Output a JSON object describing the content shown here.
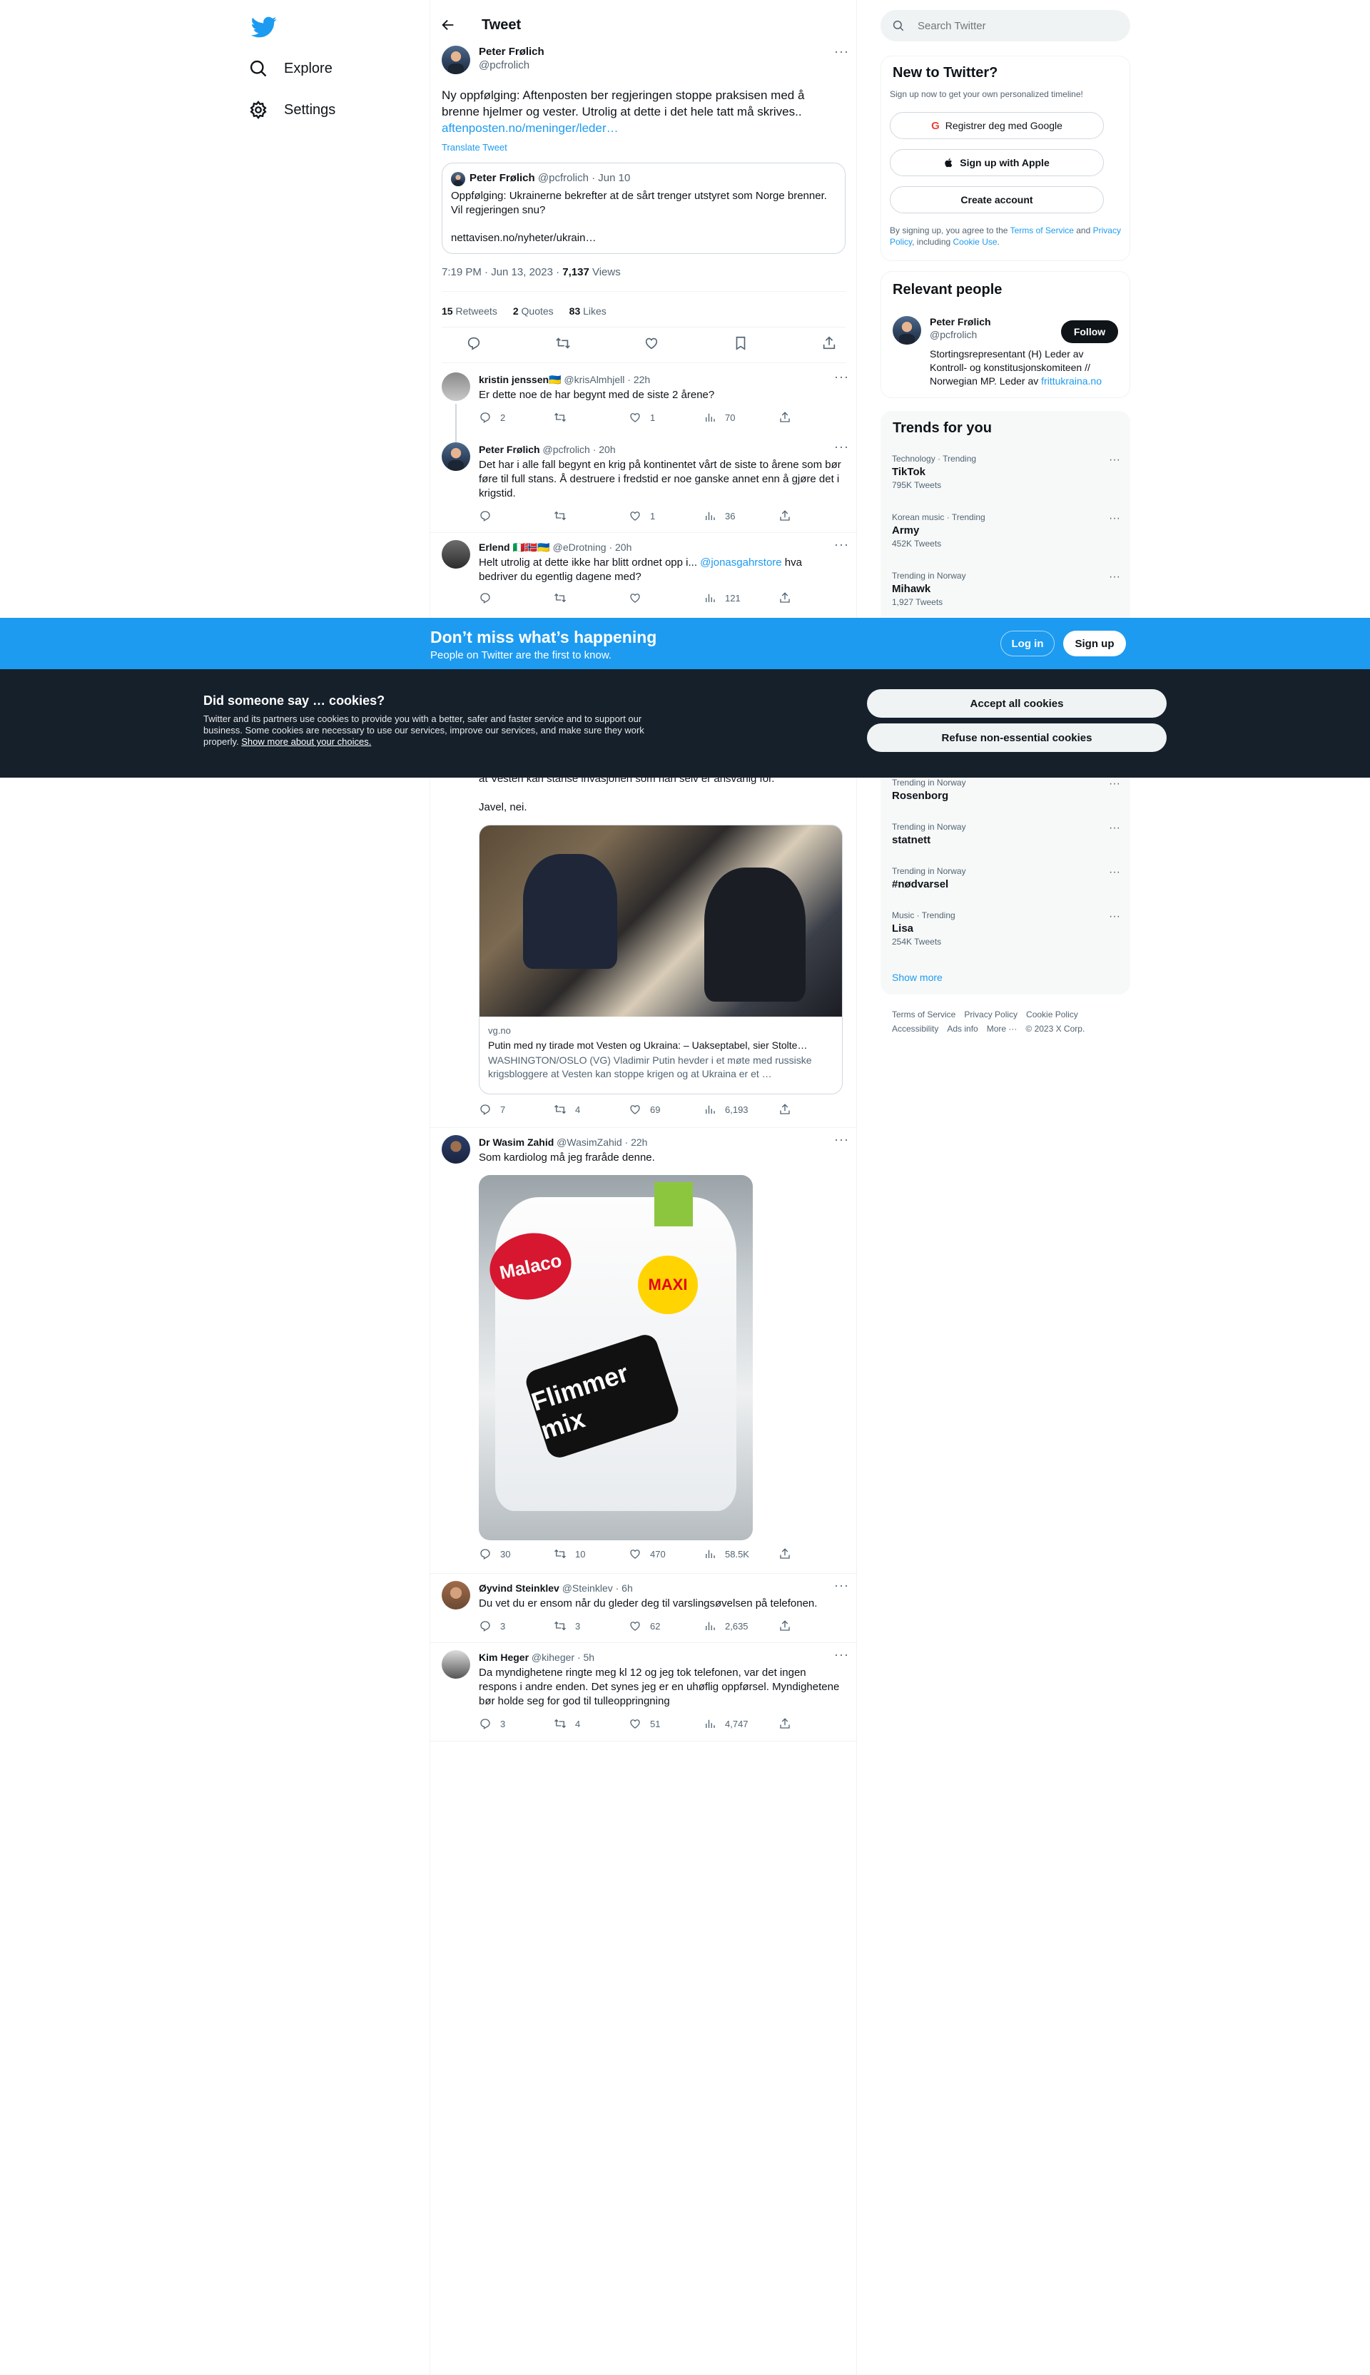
{
  "nav": {
    "explore": "Explore",
    "settings": "Settings"
  },
  "header": {
    "title": "Tweet"
  },
  "main_tweet": {
    "name": "Peter Frølich",
    "handle": "@pcfrolich",
    "text": "Ny oppfølging: Aftenposten ber regjeringen stoppe praksisen med å brenne hjelmer og vester. Utrolig at dette i det hele tatt må skrives..",
    "link": "aftenposten.no/meninger/leder…",
    "translate": "Translate Tweet",
    "quote": {
      "name": "Peter Frølich",
      "handle": "@pcfrolich · Jun 10",
      "text": "Oppfølging: Ukrainerne bekrefter at de sårt trenger utstyret som Norge brenner. Vil regjeringen snu?",
      "link": "nettavisen.no/nyheter/ukrain…"
    },
    "time": "7:19 PM · Jun 13, 2023 · ",
    "views_count": "7,137",
    "views_label": " Views",
    "retweets_count": "15",
    "retweets_label": " Retweets",
    "quotes_count": "2",
    "quotes_label": " Quotes",
    "likes_count": "83",
    "likes_label": " Likes"
  },
  "replies": [
    {
      "name": "kristin jenssen🇺🇦",
      "handle": "@krisAlmhjell · 22h",
      "text": "Er dette noe de har begynt med de siste 2 årene?",
      "replies": "2",
      "retweets": "",
      "likes": "1",
      "views": "70"
    },
    {
      "name": "Peter Frølich",
      "handle": "@pcfrolich · 20h",
      "text": "Det har i alle fall begynt en krig på kontinentet vårt de siste to årene som bør føre til full stans. Å destruere i fredstid er noe ganske annet enn å gjøre det i krigstid.",
      "replies": "",
      "retweets": "",
      "likes": "1",
      "views": "36"
    },
    {
      "name": "Erlend 🇮🇹🇳🇴🇺🇦",
      "handle": "@eDrotning · 20h",
      "text": "Helt utrolig at dette ikke har blitt ordnet opp i... ",
      "mention": "@jonasgahrstore",
      "text2": " hva bedriver du egentlig dagene med?",
      "replies": "",
      "retweets": "",
      "likes": "",
      "views": "121"
    },
    {
      "partial_text": "at Vesten kan stanse invasjonen som han selv er ansvarlig for.",
      "text": "Javel, nei.",
      "card": {
        "domain": "vg.no",
        "title": "Putin med ny tirade mot Vesten og Ukraina: – Uakseptabel, sier Stolte…",
        "desc": "WASHINGTON/OSLO (VG) Vladimir Putin hevder i et møte med russiske krigsbloggere at Vesten kan stoppe krigen og at Ukraina er et …"
      },
      "replies": "7",
      "retweets": "4",
      "likes": "69",
      "views": "6,193"
    },
    {
      "name": "Dr Wasim Zahid",
      "handle": "@WasimZahid · 22h",
      "text": "Som kardiolog må jeg fraråde denne.",
      "image_text": {
        "brand": "Malaco",
        "maxi": "MAXI",
        "product": "Flimmer mix"
      },
      "replies": "30",
      "retweets": "10",
      "likes": "470",
      "views": "58.5K"
    },
    {
      "name": "Øyvind Steinklev",
      "handle": "@Steinklev · 6h",
      "text": "Du vet du er ensom når du gleder deg til varslingsøvelsen på telefonen.",
      "replies": "3",
      "retweets": "3",
      "likes": "62",
      "views": "2,635"
    },
    {
      "name": "Kim Heger",
      "handle": "@kiheger · 5h",
      "text": "Da myndighetene ringte meg kl 12 og jeg tok telefonen, var det ingen respons i andre enden. Det synes jeg er en uhøflig oppførsel. Myndighetene bør holde seg for god til tulleoppringning",
      "replies": "3",
      "retweets": "4",
      "likes": "51",
      "views": "4,747"
    }
  ],
  "search": {
    "placeholder": "Search Twitter"
  },
  "signup_box": {
    "title": "New to Twitter?",
    "subtitle": "Sign up now to get your own personalized timeline!",
    "google": "Registrer deg med Google",
    "apple": "Sign up with Apple",
    "create": "Create account",
    "legal1": "By signing up, you agree to the ",
    "tos": "Terms of Service",
    "legal2": " and ",
    "privacy": "Privacy Policy",
    "legal3": ", including ",
    "cookie": "Cookie Use",
    "legal4": "."
  },
  "relevant": {
    "title": "Relevant people",
    "name": "Peter Frølich",
    "handle": "@pcfrolich",
    "follow": "Follow",
    "bio": "Stortingsrepresentant (H) Leder av Kontroll- og konstitusjonskomiteen // Norwegian MP. Leder av ",
    "bio_link": "frittukraina.no"
  },
  "trends": {
    "title": "Trends for you",
    "items": [
      {
        "context": "Technology · Trending",
        "topic": "TikTok",
        "count": "795K Tweets"
      },
      {
        "context": "Korean music · Trending",
        "topic": "Army",
        "count": "452K Tweets"
      },
      {
        "context": "Trending in Norway",
        "topic": "Mihawk",
        "count": "1,927 Tweets"
      },
      {
        "context": "Trending in Norway",
        "topic": "Rosenborg",
        "count": ""
      },
      {
        "context": "Trending in Norway",
        "topic": "statnett",
        "count": ""
      },
      {
        "context": "Trending in Norway",
        "topic": "#nødvarsel",
        "count": ""
      },
      {
        "context": "Music · Trending",
        "topic": "Lisa",
        "count": "254K Tweets"
      }
    ],
    "show_more": "Show more"
  },
  "footer": {
    "tos": "Terms of Service",
    "privacy": "Privacy Policy",
    "cookie": "Cookie Policy",
    "accessibility": "Accessibility",
    "ads": "Ads info",
    "more": "More ···",
    "copyright": "© 2023 X Corp."
  },
  "banner": {
    "title": "Don’t miss what’s happening",
    "subtitle": "People on Twitter are the first to know.",
    "login": "Log in",
    "signup": "Sign up"
  },
  "cookies": {
    "title": "Did someone say … cookies?",
    "body": "Twitter and its partners use cookies to provide you with a better, safer and faster service and to support our business. Some cookies are necessary to use our services, improve our services, and make sure they work properly. ",
    "link": "Show more about your choices.",
    "accept": "Accept all cookies",
    "refuse": "Refuse non-essential cookies"
  },
  "colors": {
    "accent": "#1d9bf0",
    "cookie_bg": "#15202b"
  }
}
